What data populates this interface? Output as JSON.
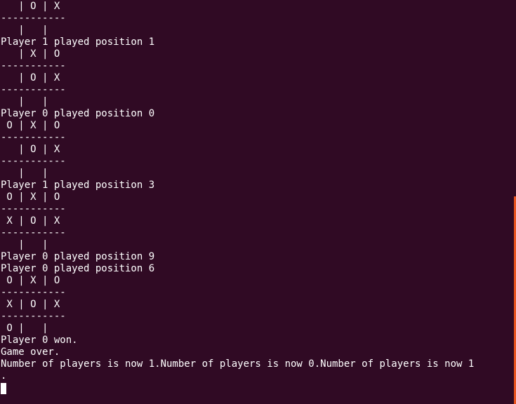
{
  "terminal": {
    "lines": [
      "   | O | X",
      "-----------",
      "   |   |",
      "Player 1 played position 1",
      "   | X | O",
      "-----------",
      "   | O | X",
      "-----------",
      "   |   |",
      "Player 0 played position 0",
      " O | X | O",
      "-----------",
      "   | O | X",
      "-----------",
      "   |   |",
      "Player 1 played position 3",
      " O | X | O",
      "-----------",
      " X | O | X",
      "-----------",
      "   |   |",
      "Player 0 played position 9",
      "Player 0 played position 6",
      " O | X | O",
      "-----------",
      " X | O | X",
      "-----------",
      " O |   |",
      "Player 0 won.",
      "Game over.",
      "Number of players is now 1.Number of players is now 0.Number of players is now 1",
      "."
    ],
    "colors": {
      "background": "#300a24",
      "text": "#ffffff",
      "scrollbar": "#e95420"
    }
  }
}
